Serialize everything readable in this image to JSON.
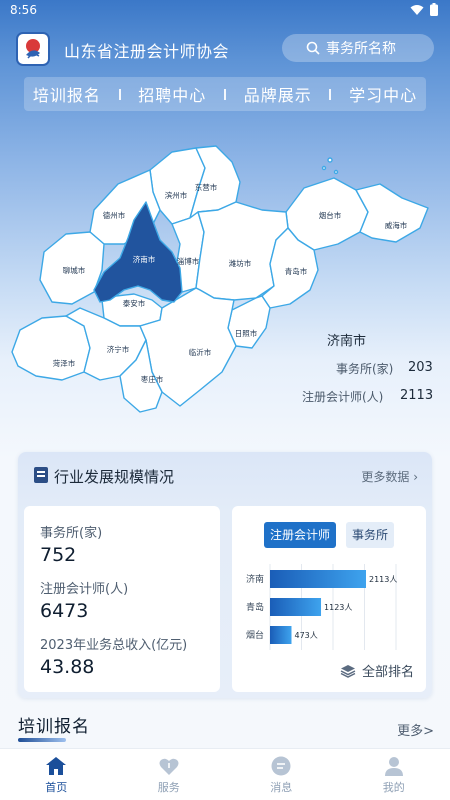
{
  "status_bar": {
    "time": "8:56"
  },
  "header": {
    "title": "山东省注册会计师协会",
    "search_placeholder": "事务所名称"
  },
  "nav": {
    "items": [
      "培训报名",
      "招聘中心",
      "品牌展示",
      "学习中心"
    ]
  },
  "map": {
    "selected_city": "济南市",
    "cities": [
      {
        "name": "滨州市"
      },
      {
        "name": "东营市"
      },
      {
        "name": "德州市"
      },
      {
        "name": "烟台市"
      },
      {
        "name": "威海市"
      },
      {
        "name": "聊城市"
      },
      {
        "name": "济南市"
      },
      {
        "name": "淄博市"
      },
      {
        "name": "潍坊市"
      },
      {
        "name": "青岛市"
      },
      {
        "name": "泰安市"
      },
      {
        "name": "日照市"
      },
      {
        "name": "菏泽市"
      },
      {
        "name": "济宁市"
      },
      {
        "name": "临沂市"
      },
      {
        "name": "枣庄市"
      }
    ],
    "colors": {
      "land": "#ffffff",
      "border": "#3da8e6",
      "selected": "#21549e"
    }
  },
  "city_info": {
    "name": "济南市",
    "firms_label": "事务所(家)",
    "firms_value": "203",
    "cpa_label": "注册会计师(人)",
    "cpa_value": "2113"
  },
  "scale_card": {
    "title": "行业发展规模情况",
    "more": "更多数据",
    "stats": [
      {
        "label": "事务所(家)",
        "value": "752"
      },
      {
        "label": "注册会计师(人)",
        "value": "6473"
      },
      {
        "label": "2023年业务总收入(亿元)",
        "value": "43.88"
      }
    ],
    "tabs": {
      "active": "注册会计师",
      "inactive": "事务所"
    },
    "ranking": [
      {
        "city": "济南",
        "value": 2113,
        "label": "2113人"
      },
      {
        "city": "青岛",
        "value": 1123,
        "label": "1123人"
      },
      {
        "city": "烟台",
        "value": 473,
        "label": "473人"
      }
    ],
    "ranking_max": 2113,
    "all_rank_label": "全部排名",
    "bar_colors": {
      "start": "#1a5db7",
      "end": "#3ea3ee"
    }
  },
  "training": {
    "title": "培训报名",
    "more": "更多>"
  },
  "bottom_nav": {
    "items": [
      {
        "label": "首页",
        "icon": "home-icon",
        "active": true
      },
      {
        "label": "服务",
        "icon": "heart-icon",
        "active": false
      },
      {
        "label": "消息",
        "icon": "message-icon",
        "active": false
      },
      {
        "label": "我的",
        "icon": "user-icon",
        "active": false
      }
    ]
  }
}
